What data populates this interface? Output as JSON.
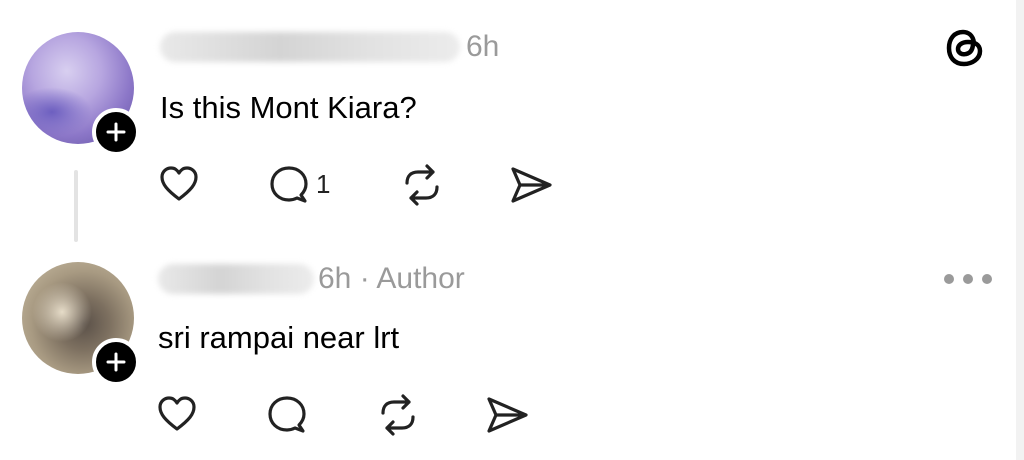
{
  "post1": {
    "time": "6h",
    "text": "Is this Mont Kiara?",
    "reply_count": "1"
  },
  "post2": {
    "meta": "6h · Author",
    "text": "sri rampai near lrt"
  },
  "icons": [
    "threads-logo-icon",
    "heart-icon",
    "comment-icon",
    "repost-icon",
    "share-icon",
    "more-icon",
    "plus-icon"
  ],
  "colors": {
    "text": "#000000",
    "muted": "#9a9a9a",
    "thread_line": "#e3e3e3"
  }
}
